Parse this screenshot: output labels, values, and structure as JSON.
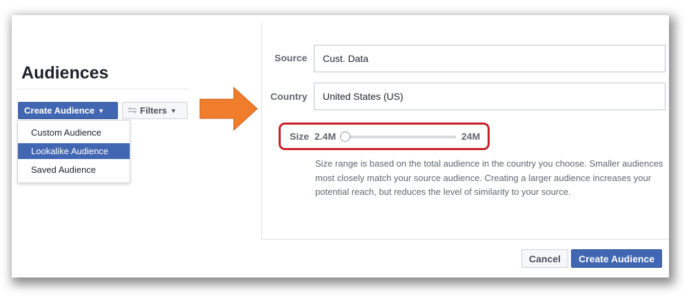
{
  "page": {
    "title": "Audiences"
  },
  "toolbar": {
    "create_label": "Create Audience",
    "caret": "▼",
    "filters_label": "Filters",
    "filters_icon": "sliders-icon"
  },
  "menu": {
    "items": [
      {
        "label": "Custom Audience",
        "highlighted": false
      },
      {
        "label": "Lookalike Audience",
        "highlighted": true
      },
      {
        "label": "Saved Audience",
        "highlighted": false
      }
    ]
  },
  "callout": {
    "arrow_color": "#ef7d2b",
    "highlight_color": "#c81d25"
  },
  "form": {
    "source_label": "Source",
    "source_value": "Cust. Data",
    "country_label": "Country",
    "country_value": "United States (US)",
    "size_label": "Size",
    "size_min": "2.4M",
    "size_max": "24M",
    "slider_position": 0,
    "help_text": "Size range is based on the total audience in the country you choose. Smaller audiences most closely match your source audience. Creating a larger audience increases your potential reach, but reduces the level of similarity to your source."
  },
  "footer": {
    "cancel_label": "Cancel",
    "create_label": "Create Audience"
  },
  "colors": {
    "primary": "#4267b2",
    "text": "#1d2129",
    "muted": "#606770"
  }
}
